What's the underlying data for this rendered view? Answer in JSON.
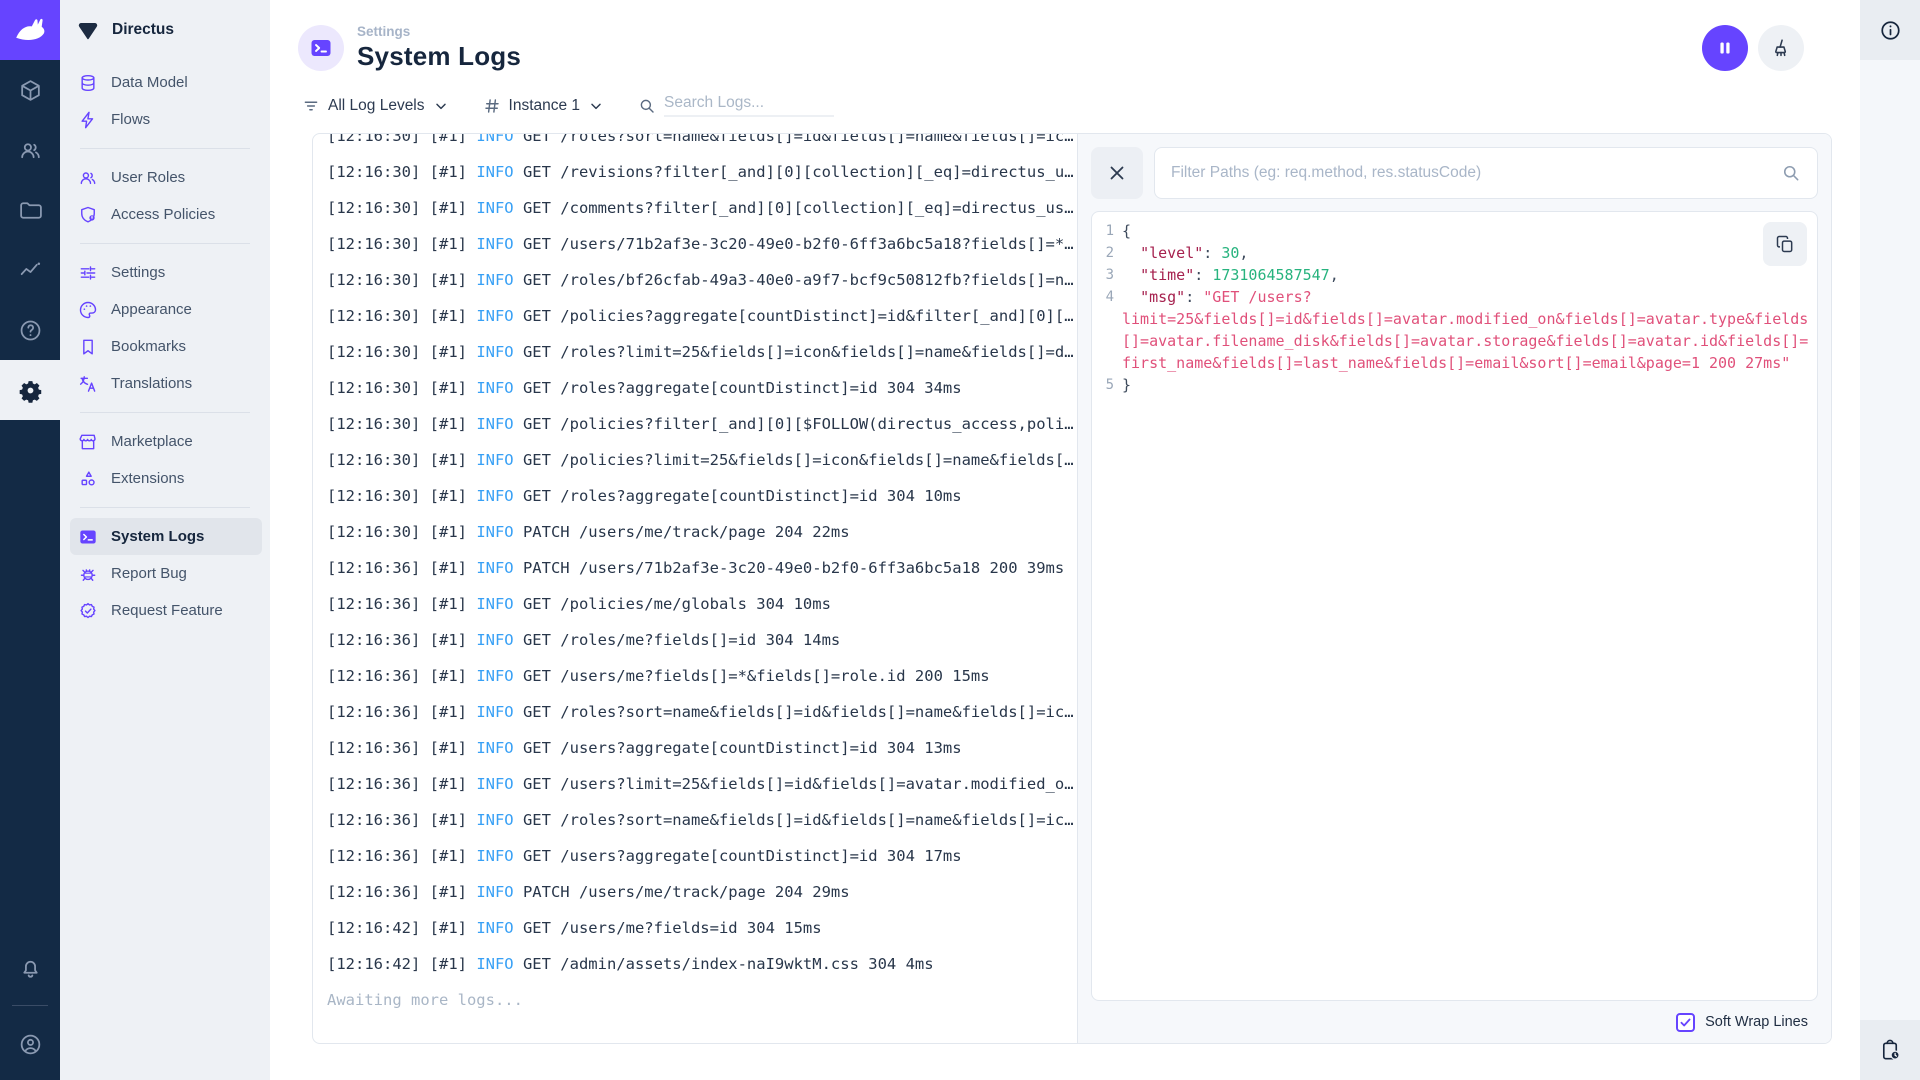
{
  "app": {
    "project_name": "Directus"
  },
  "sidebar": {
    "sections": [
      {
        "items": [
          {
            "icon": "data-model",
            "label": "Data Model",
            "active": false
          },
          {
            "icon": "flows",
            "label": "Flows",
            "active": false
          }
        ]
      },
      {
        "items": [
          {
            "icon": "user-roles",
            "label": "User Roles",
            "active": false
          },
          {
            "icon": "access-policies",
            "label": "Access Policies",
            "active": false
          }
        ]
      },
      {
        "items": [
          {
            "icon": "settings",
            "label": "Settings",
            "active": false
          },
          {
            "icon": "appearance",
            "label": "Appearance",
            "active": false
          },
          {
            "icon": "bookmarks",
            "label": "Bookmarks",
            "active": false
          },
          {
            "icon": "translations",
            "label": "Translations",
            "active": false
          }
        ]
      },
      {
        "items": [
          {
            "icon": "marketplace",
            "label": "Marketplace",
            "active": false
          },
          {
            "icon": "extensions",
            "label": "Extensions",
            "active": false
          }
        ]
      },
      {
        "items": [
          {
            "icon": "system-logs",
            "label": "System Logs",
            "active": true
          },
          {
            "icon": "report-bug",
            "label": "Report Bug",
            "active": false
          },
          {
            "icon": "request-feature",
            "label": "Request Feature",
            "active": false
          }
        ]
      }
    ]
  },
  "header": {
    "kicker": "Settings",
    "title": "System Logs"
  },
  "filters": {
    "log_levels_label": "All Log Levels",
    "instance_label": "Instance 1",
    "search_placeholder": "Search Logs..."
  },
  "logs": {
    "awaiting_text": "Awaiting more logs...",
    "entries": [
      {
        "time": "12:16:30",
        "tag": "#1",
        "level": "INFO",
        "message": "GET /roles?sort=name&fields[]=id&fields[]=name&fields[]=ic…"
      },
      {
        "time": "12:16:30",
        "tag": "#1",
        "level": "INFO",
        "message": "GET /revisions?filter[_and][0][collection][_eq]=directus_u…"
      },
      {
        "time": "12:16:30",
        "tag": "#1",
        "level": "INFO",
        "message": "GET /comments?filter[_and][0][collection][_eq]=directus_us…"
      },
      {
        "time": "12:16:30",
        "tag": "#1",
        "level": "INFO",
        "message": "GET /users/71b2af3e-3c20-49e0-b2f0-6ff3a6bc5a18?fields[]=*…"
      },
      {
        "time": "12:16:30",
        "tag": "#1",
        "level": "INFO",
        "message": "GET /roles/bf26cfab-49a3-40e0-a9f7-bcf9c50812fb?fields[]=n…"
      },
      {
        "time": "12:16:30",
        "tag": "#1",
        "level": "INFO",
        "message": "GET /policies?aggregate[countDistinct]=id&filter[_and][0][…"
      },
      {
        "time": "12:16:30",
        "tag": "#1",
        "level": "INFO",
        "message": "GET /roles?limit=25&fields[]=icon&fields[]=name&fields[]=d…"
      },
      {
        "time": "12:16:30",
        "tag": "#1",
        "level": "INFO",
        "message": "GET /roles?aggregate[countDistinct]=id 304 34ms"
      },
      {
        "time": "12:16:30",
        "tag": "#1",
        "level": "INFO",
        "message": "GET /policies?filter[_and][0][$FOLLOW(directus_access,poli…"
      },
      {
        "time": "12:16:30",
        "tag": "#1",
        "level": "INFO",
        "message": "GET /policies?limit=25&fields[]=icon&fields[]=name&fields[…"
      },
      {
        "time": "12:16:30",
        "tag": "#1",
        "level": "INFO",
        "message": "GET /roles?aggregate[countDistinct]=id 304 10ms"
      },
      {
        "time": "12:16:30",
        "tag": "#1",
        "level": "INFO",
        "message": "PATCH /users/me/track/page 204 22ms"
      },
      {
        "time": "12:16:36",
        "tag": "#1",
        "level": "INFO",
        "message": "PATCH /users/71b2af3e-3c20-49e0-b2f0-6ff3a6bc5a18 200 39ms"
      },
      {
        "time": "12:16:36",
        "tag": "#1",
        "level": "INFO",
        "message": "GET /policies/me/globals 304 10ms"
      },
      {
        "time": "12:16:36",
        "tag": "#1",
        "level": "INFO",
        "message": "GET /roles/me?fields[]=id 304 14ms"
      },
      {
        "time": "12:16:36",
        "tag": "#1",
        "level": "INFO",
        "message": "GET /users/me?fields[]=*&fields[]=role.id 200 15ms"
      },
      {
        "time": "12:16:36",
        "tag": "#1",
        "level": "INFO",
        "message": "GET /roles?sort=name&fields[]=id&fields[]=name&fields[]=ic…"
      },
      {
        "time": "12:16:36",
        "tag": "#1",
        "level": "INFO",
        "message": "GET /users?aggregate[countDistinct]=id 304 13ms"
      },
      {
        "time": "12:16:36",
        "tag": "#1",
        "level": "INFO",
        "message": "GET /users?limit=25&fields[]=id&fields[]=avatar.modified_o…"
      },
      {
        "time": "12:16:36",
        "tag": "#1",
        "level": "INFO",
        "message": "GET /roles?sort=name&fields[]=id&fields[]=name&fields[]=ic…"
      },
      {
        "time": "12:16:36",
        "tag": "#1",
        "level": "INFO",
        "message": "GET /users?aggregate[countDistinct]=id 304 17ms"
      },
      {
        "time": "12:16:36",
        "tag": "#1",
        "level": "INFO",
        "message": "PATCH /users/me/track/page 204 29ms"
      },
      {
        "time": "12:16:42",
        "tag": "#1",
        "level": "INFO",
        "message": "GET /users/me?fields=id 304 15ms"
      },
      {
        "time": "12:16:42",
        "tag": "#1",
        "level": "INFO",
        "message": "GET /admin/assets/index-naI9wktM.css 304 4ms"
      }
    ]
  },
  "detail": {
    "filter_placeholder": "Filter Paths (eg: req.method, res.statusCode)",
    "soft_wrap_label": "Soft Wrap Lines",
    "soft_wrap_checked": true,
    "code": {
      "lines": [
        {
          "num": "1",
          "parts": [
            [
              "p",
              "{"
            ]
          ]
        },
        {
          "num": "2",
          "parts": [
            [
              "p",
              "  "
            ],
            [
              "k",
              "\"level\""
            ],
            [
              "p",
              ": "
            ],
            [
              "n",
              "30"
            ],
            [
              "p",
              ","
            ]
          ]
        },
        {
          "num": "3",
          "parts": [
            [
              "p",
              "  "
            ],
            [
              "k",
              "\"time\""
            ],
            [
              "p",
              ": "
            ],
            [
              "n",
              "1731064587547"
            ],
            [
              "p",
              ","
            ]
          ]
        },
        {
          "num": "4",
          "parts": [
            [
              "p",
              "  "
            ],
            [
              "k",
              "\"msg\""
            ],
            [
              "p",
              ": "
            ],
            [
              "s",
              "\"GET /users?"
            ]
          ]
        },
        {
          "num": "",
          "parts": [
            [
              "s",
              "limit=25&fields[]=id&fields[]=avatar.modified_on&fields[]=avatar.type&fields"
            ]
          ]
        },
        {
          "num": "",
          "parts": [
            [
              "s",
              "[]=avatar.filename_disk&fields[]=avatar.storage&fields[]=avatar.id&fields[]="
            ]
          ]
        },
        {
          "num": "",
          "parts": [
            [
              "s",
              "first_name&fields[]=last_name&fields[]=email&sort[]=email&page=1 200 27ms\""
            ]
          ]
        },
        {
          "num": "5",
          "parts": [
            [
              "p",
              "}"
            ]
          ]
        }
      ]
    }
  },
  "colors": {
    "accent": "#6644ff",
    "module_bar": "#132a45",
    "info_level": "#38a0f5",
    "json_key": "#a6214e",
    "json_string": "#e0507a",
    "json_number": "#27b37e"
  }
}
